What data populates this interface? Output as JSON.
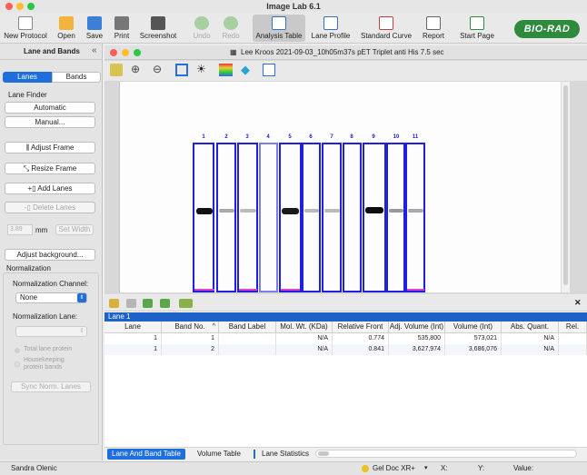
{
  "app": {
    "title": "Image Lab 6.1"
  },
  "toolbar": {
    "new_protocol": "New Protocol",
    "open": "Open",
    "save": "Save",
    "print": "Print",
    "screenshot": "Screenshot",
    "undo": "Undo",
    "redo": "Redo",
    "analysis_table": "Analysis Table",
    "lane_profile": "Lane Profile",
    "standard_curve": "Standard Curve",
    "report": "Report",
    "start_page": "Start Page",
    "logo": "BIO-RAD"
  },
  "left_panel": {
    "title": "Lane and Bands",
    "tab_lanes": "Lanes",
    "tab_bands": "Bands",
    "lane_finder": "Lane Finder",
    "automatic": "Automatic",
    "manual": "Manual...",
    "adjust_frame": "Adjust Frame",
    "resize_frame": "Resize Frame",
    "add_lanes": "Add Lanes",
    "delete_lanes": "Delete Lanes",
    "width_value": "3.89",
    "width_unit": "mm",
    "set_width": "Set Width",
    "adjust_background": "Adjust background...",
    "normalization": "Normalization",
    "norm_channel_label": "Normalization Channel:",
    "norm_channel_value": "None",
    "norm_lane_label": "Normalization Lane:",
    "opt_total": "Total lane protein",
    "opt_housekeeping": "Housekeeping protein bands",
    "sync_lanes": "Sync Norm. Lanes"
  },
  "image_window": {
    "title": "Lee Kroos 2021-09-03_10h05m37s pET Triplet anti His 7.5 sec",
    "lane_numbers": [
      "1",
      "2",
      "3",
      "4",
      "5",
      "6",
      "7",
      "8",
      "9",
      "10",
      "11"
    ]
  },
  "table": {
    "lane_header": "Lane 1",
    "columns": [
      "Lane",
      "Band No.",
      "Band Label",
      "Mol. Wt. (KDa)",
      "Relative Front",
      "Adj. Volume (Int)",
      "Volume (Int)",
      "Abs. Quant.",
      "Rel."
    ],
    "rows": [
      {
        "lane": "1",
        "band_no": "1",
        "band_label": "",
        "mol_wt": "N/A",
        "rel_front": "0.774",
        "adj_volume": "535,800",
        "volume": "573,021",
        "abs_quant": "N/A",
        "rel": ""
      },
      {
        "lane": "1",
        "band_no": "2",
        "band_label": "",
        "mol_wt": "N/A",
        "rel_front": "0.841",
        "adj_volume": "3,627,974",
        "volume": "3,686,076",
        "abs_quant": "N/A",
        "rel": ""
      }
    ]
  },
  "bottom_tabs": {
    "tab1": "Lane And Band Table",
    "tab2": "Volume Table",
    "tab3": "Lane Statistics"
  },
  "status": {
    "user": "Sandra Olenic",
    "device": "Gel Doc XR+",
    "x_label": "X:",
    "y_label": "Y:",
    "value_label": "Value:"
  }
}
